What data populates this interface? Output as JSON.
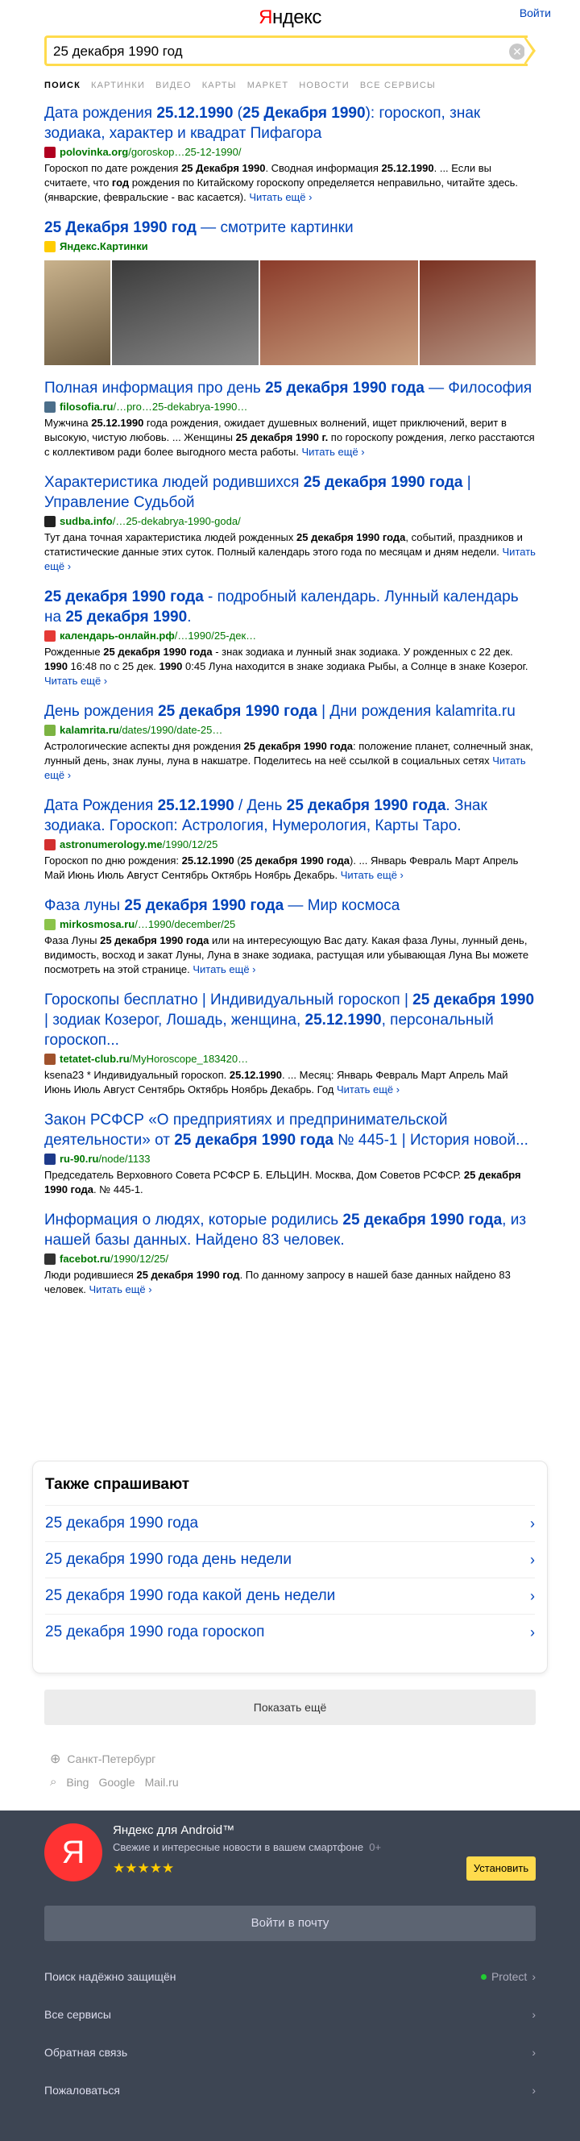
{
  "header": {
    "logo": "Яндекс",
    "login": "Войти"
  },
  "search": {
    "value": "25 декабря 1990 год",
    "clear_icon": "close-icon"
  },
  "tabs": [
    "поиск",
    "картинки",
    "видео",
    "карты",
    "маркет",
    "новости",
    "все сервисы"
  ],
  "results": [
    {
      "title": "Дата рождения 25.12.1990 (25 Декабря 1990): гороскоп, знак зодиака, характер и квадрат Пифагора",
      "host": "polovinka.org",
      "path": "/goroskop…25-12-1990/",
      "text": "Гороскоп по дате рождения 25 Декабря 1990. Сводная информация 25.12.1990. ... Если вы считаете, что год рождения по Китайскому гороскопу определяется неправильно, читайте здесь. (январские, февральские - вас касается).",
      "more": "Читать ещё ›",
      "favicon_color": "#b00020"
    },
    {
      "title": "25 Декабря 1990 год — смотрите картинки",
      "host": "Яндекс.Картинки",
      "path": "",
      "text": "",
      "more": "",
      "favicon_color": "#ffcc00"
    },
    {
      "title": "Полная информация про день 25 декабря 1990 года — Философия",
      "host": "filosofia.ru",
      "path": "/…pro…25-dekabrya-1990…",
      "text": "Мужчина 25.12.1990 года рождения, ожидает душевных волнений, ищет приключений, верит в высокую, чистую любовь. ... Женщины 25 декабря 1990 г. по гороскопу рождения, легко расстаются с коллективом ради более выгодного места работы.",
      "more": "Читать ещё ›",
      "favicon_color": "#4b6e8a"
    },
    {
      "title": "Характеристика людей родившихся 25 декабря 1990 года | Управление Судьбой",
      "host": "sudba.info",
      "path": "/…25-dekabrya-1990-goda/",
      "text": "Тут дана точная характеристика людей рожденных 25 декабря 1990 года, событий, праздников и статистические данные этих суток. Полный календарь этого года по месяцам и дням недели.",
      "more": "Читать ещё ›",
      "favicon_color": "#222222"
    },
    {
      "title": "25 декабря 1990 года - подробный календарь. Лунный календарь на 25 декабря 1990.",
      "host": "календарь-онлайн.рф",
      "path": "/…1990/25-дек…",
      "text": "Рожденные 25 декабря 1990 года - знак зодиака и лунный знак зодиака. У рожденных с 22 дек. 1990 16:48 по с 25 дек. 1990 0:45 Луна находится в знаке зодиака Рыбы, а Солнце в знаке Козерог.",
      "more": "Читать ещё ›",
      "favicon_color": "#e53935"
    },
    {
      "title": "День рождения 25 декабря 1990 года | Дни рождения kalamrita.ru",
      "host": "kalamrita.ru",
      "path": "/dates/1990/date-25…",
      "text": "Астрологические аспекты дня рождения 25 декабря 1990 года: положение планет, солнечный знак, лунный день, знак луны, луна в накшатре. Поделитесь на неё ссылкой в социальных сетях",
      "more": "Читать ещё ›",
      "favicon_color": "#7cb342"
    },
    {
      "title": "Дата Рождения 25.12.1990 / День 25 декабря 1990 года. Знак зодиака. Гороскоп: Астрология, Нумерология, Карты Таро.",
      "host": "astronumerology.me",
      "path": "/1990/12/25",
      "text": "Гороскоп по дню рождения: 25.12.1990 (25 декабря 1990 года). ... Январь Февраль Март Апрель Май Июнь Июль Август Сентябрь Октябрь Ноябрь Декабрь.",
      "more": "Читать ещё ›",
      "favicon_color": "#d32f2f"
    },
    {
      "title": "Фаза луны 25 декабря 1990 года — Мир космоса",
      "host": "mirkosmosa.ru",
      "path": "/…1990/december/25",
      "text": "Фаза Луны 25 декабря 1990 года или на интересующую Вас дату. Какая фаза Луны, лунный день, видимость, восход и закат Луны, Луна в знаке зодиака, растущая или убывающая Луна Вы можете посмотреть на этой странице.",
      "more": "Читать ещё ›",
      "favicon_color": "#8bc34a"
    },
    {
      "title": "Гороскопы бесплатно | Индивидуальный гороскоп | 25 декабря 1990 | зодиак Козерог, Лошадь, женщина, 25.12.1990, персональный гороскоп...",
      "host": "tetatet-club.ru",
      "path": "/MyHoroscope_183420…",
      "text": "ksena23 * Индивидуальный гороскоп. 25.12.1990. ... Месяц: Январь Февраль Март Апрель Май Июнь Июль Август Сентябрь Октябрь Ноябрь Декабрь. Год",
      "more": "Читать ещё ›",
      "favicon_color": "#a0522d"
    },
    {
      "title": "Закон РСФСР «О предприятиях и предпринимательской деятельности» от 25 декабря 1990 года № 445-1 | История новой...",
      "host": "ru-90.ru",
      "path": "/node/1133",
      "text": "Председатель Верховного Совета РСФСР Б. ЕЛЬЦИН. Москва, Дом Советов РСФСР. 25 декабря 1990 года. № 445-1.",
      "more": "",
      "favicon_color": "#1e3a8a"
    },
    {
      "title": "Информация о людях, которые родились 25 декабря 1990 года, из нашей базы данных. Найдено 83 человек.",
      "host": "facebot.ru",
      "path": "/1990/12/25/",
      "text": "Люди родившиеся 25 декабря 1990 год. По данному запросу в нашей базе данных найдено 83 человек.",
      "more": "Читать ещё ›",
      "favicon_color": "#333333"
    }
  ],
  "also_ask": {
    "title": "Также спрашивают",
    "items": [
      "25 декабря 1990 года",
      "25 декабря 1990 года день недели",
      "25 декабря 1990 года какой день недели",
      "25 декабря 1990 года гороскоп"
    ]
  },
  "more_button": "Показать ещё",
  "region": "Санкт-Петербург",
  "engines": [
    "Bing",
    "Google",
    "Mail.ru"
  ],
  "footer": {
    "app_icon_letter": "Я",
    "app_title": "Яндекс для Android™",
    "app_sub": "Свежие и интересные новости в вашем смартфоне",
    "age": "0+",
    "stars": "★★★★★",
    "rating": 4.5,
    "install": "Установить",
    "mail_button": "Войти в почту",
    "rows": [
      {
        "label": "Поиск надёжно защищён",
        "right": "Protect"
      },
      {
        "label": "Все сервисы",
        "right": ""
      },
      {
        "label": "Обратная связь",
        "right": ""
      },
      {
        "label": "Пожаловаться",
        "right": ""
      }
    ]
  }
}
